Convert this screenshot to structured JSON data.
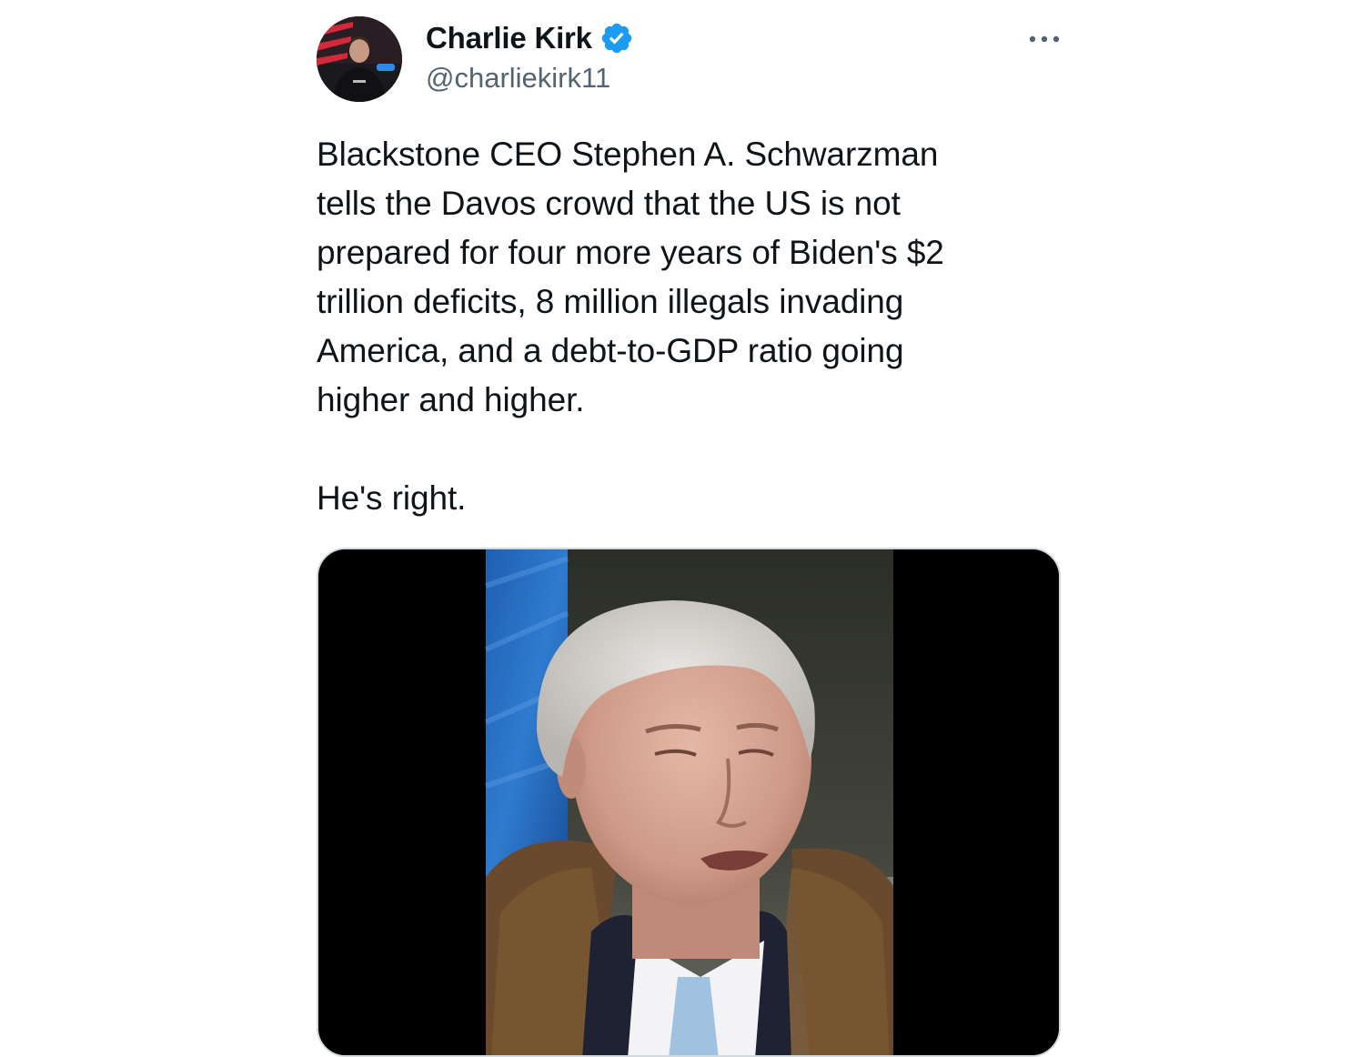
{
  "tweet": {
    "author": {
      "display_name": "Charlie Kirk",
      "handle": "@charliekirk11",
      "verified": true,
      "avatar_icon": "profile-photo"
    },
    "more_icon": "more-horizontal-icon",
    "text": "Blackstone CEO Stephen A. Schwarzman\ntells the Davos crowd that the US is not\nprepared for four more years of Biden's $2\ntrillion deficits, 8 million illegals invading\nAmerica, and a debt-to-GDP ratio going\nhigher and higher.\n\nHe's right.",
    "media": {
      "type": "video",
      "thumbnail_icon": "video-thumbnail"
    }
  },
  "colors": {
    "text_primary": "#0f1419",
    "text_secondary": "#536471",
    "verified_blue": "#1d9bf0",
    "media_border": "#cfd9de"
  }
}
